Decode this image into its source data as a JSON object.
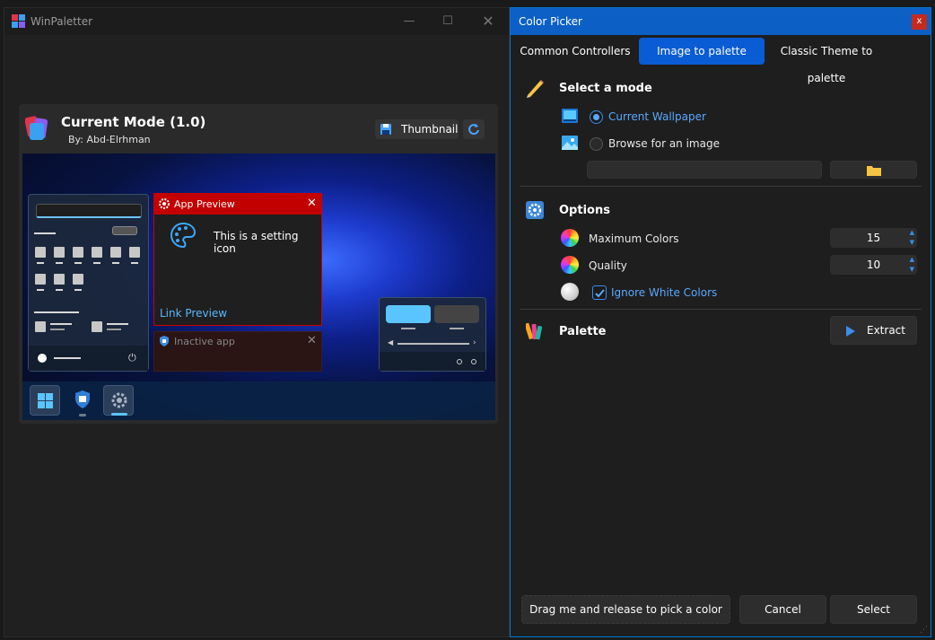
{
  "winpaletter": {
    "title": "WinPaletter",
    "card": {
      "title": "Current Mode (1.0)",
      "author": "By: Abd-Elrhman",
      "thumbnail_label": "Thumbnail"
    },
    "preview": {
      "app_preview_title": "App Preview",
      "setting_icon_text": "This is a setting icon",
      "link_text": "Link Preview",
      "inactive_title": "Inactive app"
    }
  },
  "color_picker": {
    "title": "Color Picker",
    "close_label": "x",
    "tabs": [
      {
        "label": "Common Controllers",
        "active": false
      },
      {
        "label": "Image to palette",
        "active": true
      },
      {
        "label": "Classic Theme to palette",
        "active": false
      }
    ],
    "mode": {
      "title": "Select a mode",
      "options": [
        {
          "label": "Current Wallpaper",
          "selected": true
        },
        {
          "label": "Browse for an image",
          "selected": false
        }
      ],
      "path_value": ""
    },
    "options": {
      "title": "Options",
      "max_colors_label": "Maximum Colors",
      "max_colors_value": "15",
      "quality_label": "Quality",
      "quality_value": "10",
      "ignore_white_label": "Ignore White Colors",
      "ignore_white_checked": true
    },
    "palette": {
      "title": "Palette",
      "extract_label": "Extract"
    },
    "footer": {
      "drag_label": "Drag me and release to pick a color",
      "cancel_label": "Cancel",
      "select_label": "Select"
    }
  },
  "colors": {
    "accent": "#0a5cd4",
    "titlebar_blue": "#0b5fc5",
    "app_preview_red": "#c20000",
    "link_blue": "#5aa9ff"
  }
}
